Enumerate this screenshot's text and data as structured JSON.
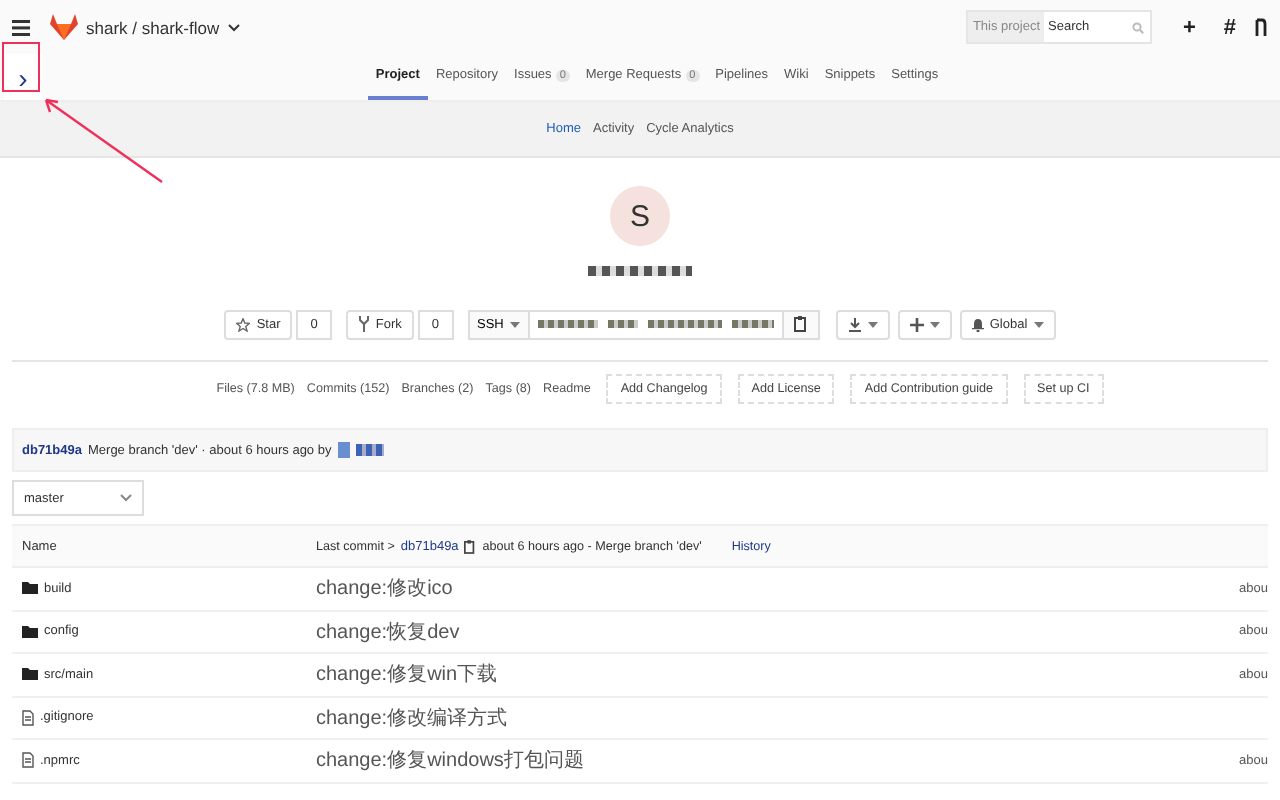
{
  "header": {
    "project_path": "shark / shark-flow",
    "search": {
      "scope": "This project",
      "placeholder": "Search"
    },
    "actions": [
      "+",
      "#"
    ]
  },
  "sidebar_toggle": {
    "glyph": "›",
    "annotated": true
  },
  "nav": {
    "tabs": [
      {
        "label": "Project",
        "selected": true
      },
      {
        "label": "Repository",
        "selected": false
      },
      {
        "label": "Issues",
        "count": "0",
        "selected": false
      },
      {
        "label": "Merge Requests",
        "count": "0",
        "selected": false
      },
      {
        "label": "Pipelines",
        "selected": false
      },
      {
        "label": "Wiki",
        "selected": false
      },
      {
        "label": "Snippets",
        "selected": false
      },
      {
        "label": "Settings",
        "selected": false
      }
    ]
  },
  "subnav": {
    "tabs": [
      {
        "label": "Home",
        "selected": true
      },
      {
        "label": "Activity",
        "selected": false
      },
      {
        "label": "Cycle Analytics",
        "selected": false
      }
    ]
  },
  "project": {
    "avatar_letter": "S",
    "star": {
      "label": "Star",
      "count": "0"
    },
    "fork": {
      "label": "Fork",
      "count": "0"
    },
    "clone_protocol": "SSH",
    "notification": "Global"
  },
  "stats": {
    "links": [
      "Files (7.8 MB)",
      "Commits (152)",
      "Branches (2)",
      "Tags (8)",
      "Readme"
    ],
    "buttons": [
      "Add Changelog",
      "Add License",
      "Add Contribution guide",
      "Set up CI"
    ]
  },
  "last_commit": {
    "sha": "db71b49a",
    "message": "Merge branch 'dev' · about 6 hours ago by"
  },
  "branch": "master",
  "table": {
    "columns": [
      "Name"
    ],
    "last_commit": {
      "prefix": "Last commit >",
      "sha": "db71b49a",
      "text": "about 6 hours ago - Merge branch 'dev'",
      "history": "History"
    },
    "rows": [
      {
        "kind": "folder",
        "name": "build",
        "message": "change:修改ico",
        "time": "abou"
      },
      {
        "kind": "folder",
        "name": "config",
        "message": "change:恢复dev",
        "time": "abou"
      },
      {
        "kind": "folder",
        "name": "src/main",
        "message": "change:修复win下载",
        "time": "abou"
      },
      {
        "kind": "file",
        "name": ".gitignore",
        "message": "change:修改编译方式"
      },
      {
        "kind": "file",
        "name": ".npmrc",
        "message": "change:修复windows打包问题",
        "time": "abou"
      }
    ]
  }
}
